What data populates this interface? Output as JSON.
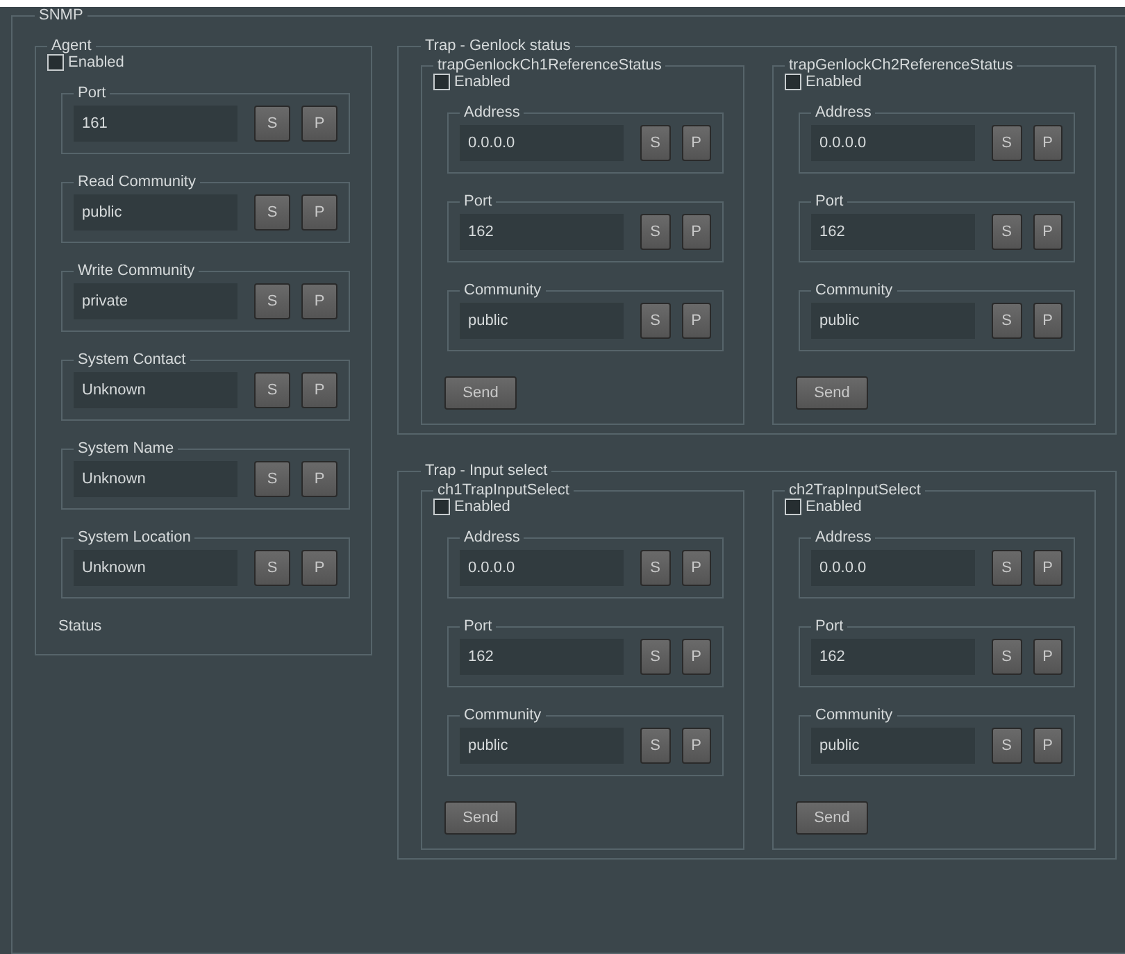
{
  "section": {
    "title": "SNMP"
  },
  "agent": {
    "title": "Agent",
    "enabled": {
      "label": "Enabled",
      "checked": false
    },
    "fields": [
      {
        "label": "Port",
        "value": "161",
        "buttons": [
          "S",
          "P"
        ]
      },
      {
        "label": "Read Community",
        "value": "public",
        "buttons": [
          "S",
          "P"
        ]
      },
      {
        "label": "Write Community",
        "value": "private",
        "buttons": [
          "S",
          "P"
        ]
      },
      {
        "label": "System Contact",
        "value": "Unknown",
        "buttons": [
          "S",
          "P"
        ]
      },
      {
        "label": "System Name",
        "value": "Unknown",
        "buttons": [
          "S",
          "P"
        ]
      },
      {
        "label": "System Location",
        "value": "Unknown",
        "buttons": [
          "S",
          "P"
        ]
      }
    ],
    "status_label": "Status"
  },
  "trap_groups": [
    {
      "title": "Trap - Genlock status",
      "channels": [
        {
          "title": "trapGenlockCh1ReferenceStatus",
          "enabled": {
            "label": "Enabled",
            "checked": false
          },
          "fields": [
            {
              "label": "Address",
              "value": "0.0.0.0",
              "buttons": [
                "S",
                "P"
              ]
            },
            {
              "label": "Port",
              "value": "162",
              "buttons": [
                "S",
                "P"
              ]
            },
            {
              "label": "Community",
              "value": "public",
              "buttons": [
                "S",
                "P"
              ]
            }
          ],
          "send": "Send"
        },
        {
          "title": "trapGenlockCh2ReferenceStatus",
          "enabled": {
            "label": "Enabled",
            "checked": false
          },
          "fields": [
            {
              "label": "Address",
              "value": "0.0.0.0",
              "buttons": [
                "S",
                "P"
              ]
            },
            {
              "label": "Port",
              "value": "162",
              "buttons": [
                "S",
                "P"
              ]
            },
            {
              "label": "Community",
              "value": "public",
              "buttons": [
                "S",
                "P"
              ]
            }
          ],
          "send": "Send"
        }
      ]
    },
    {
      "title": "Trap - Input select",
      "channels": [
        {
          "title": "ch1TrapInputSelect",
          "enabled": {
            "label": "Enabled",
            "checked": false
          },
          "fields": [
            {
              "label": "Address",
              "value": "0.0.0.0",
              "buttons": [
                "S",
                "P"
              ]
            },
            {
              "label": "Port",
              "value": "162",
              "buttons": [
                "S",
                "P"
              ]
            },
            {
              "label": "Community",
              "value": "public",
              "buttons": [
                "S",
                "P"
              ]
            }
          ],
          "send": "Send"
        },
        {
          "title": "ch2TrapInputSelect",
          "enabled": {
            "label": "Enabled",
            "checked": false
          },
          "fields": [
            {
              "label": "Address",
              "value": "0.0.0.0",
              "buttons": [
                "S",
                "P"
              ]
            },
            {
              "label": "Port",
              "value": "162",
              "buttons": [
                "S",
                "P"
              ]
            },
            {
              "label": "Community",
              "value": "public",
              "buttons": [
                "S",
                "P"
              ]
            }
          ],
          "send": "Send"
        }
      ]
    }
  ]
}
